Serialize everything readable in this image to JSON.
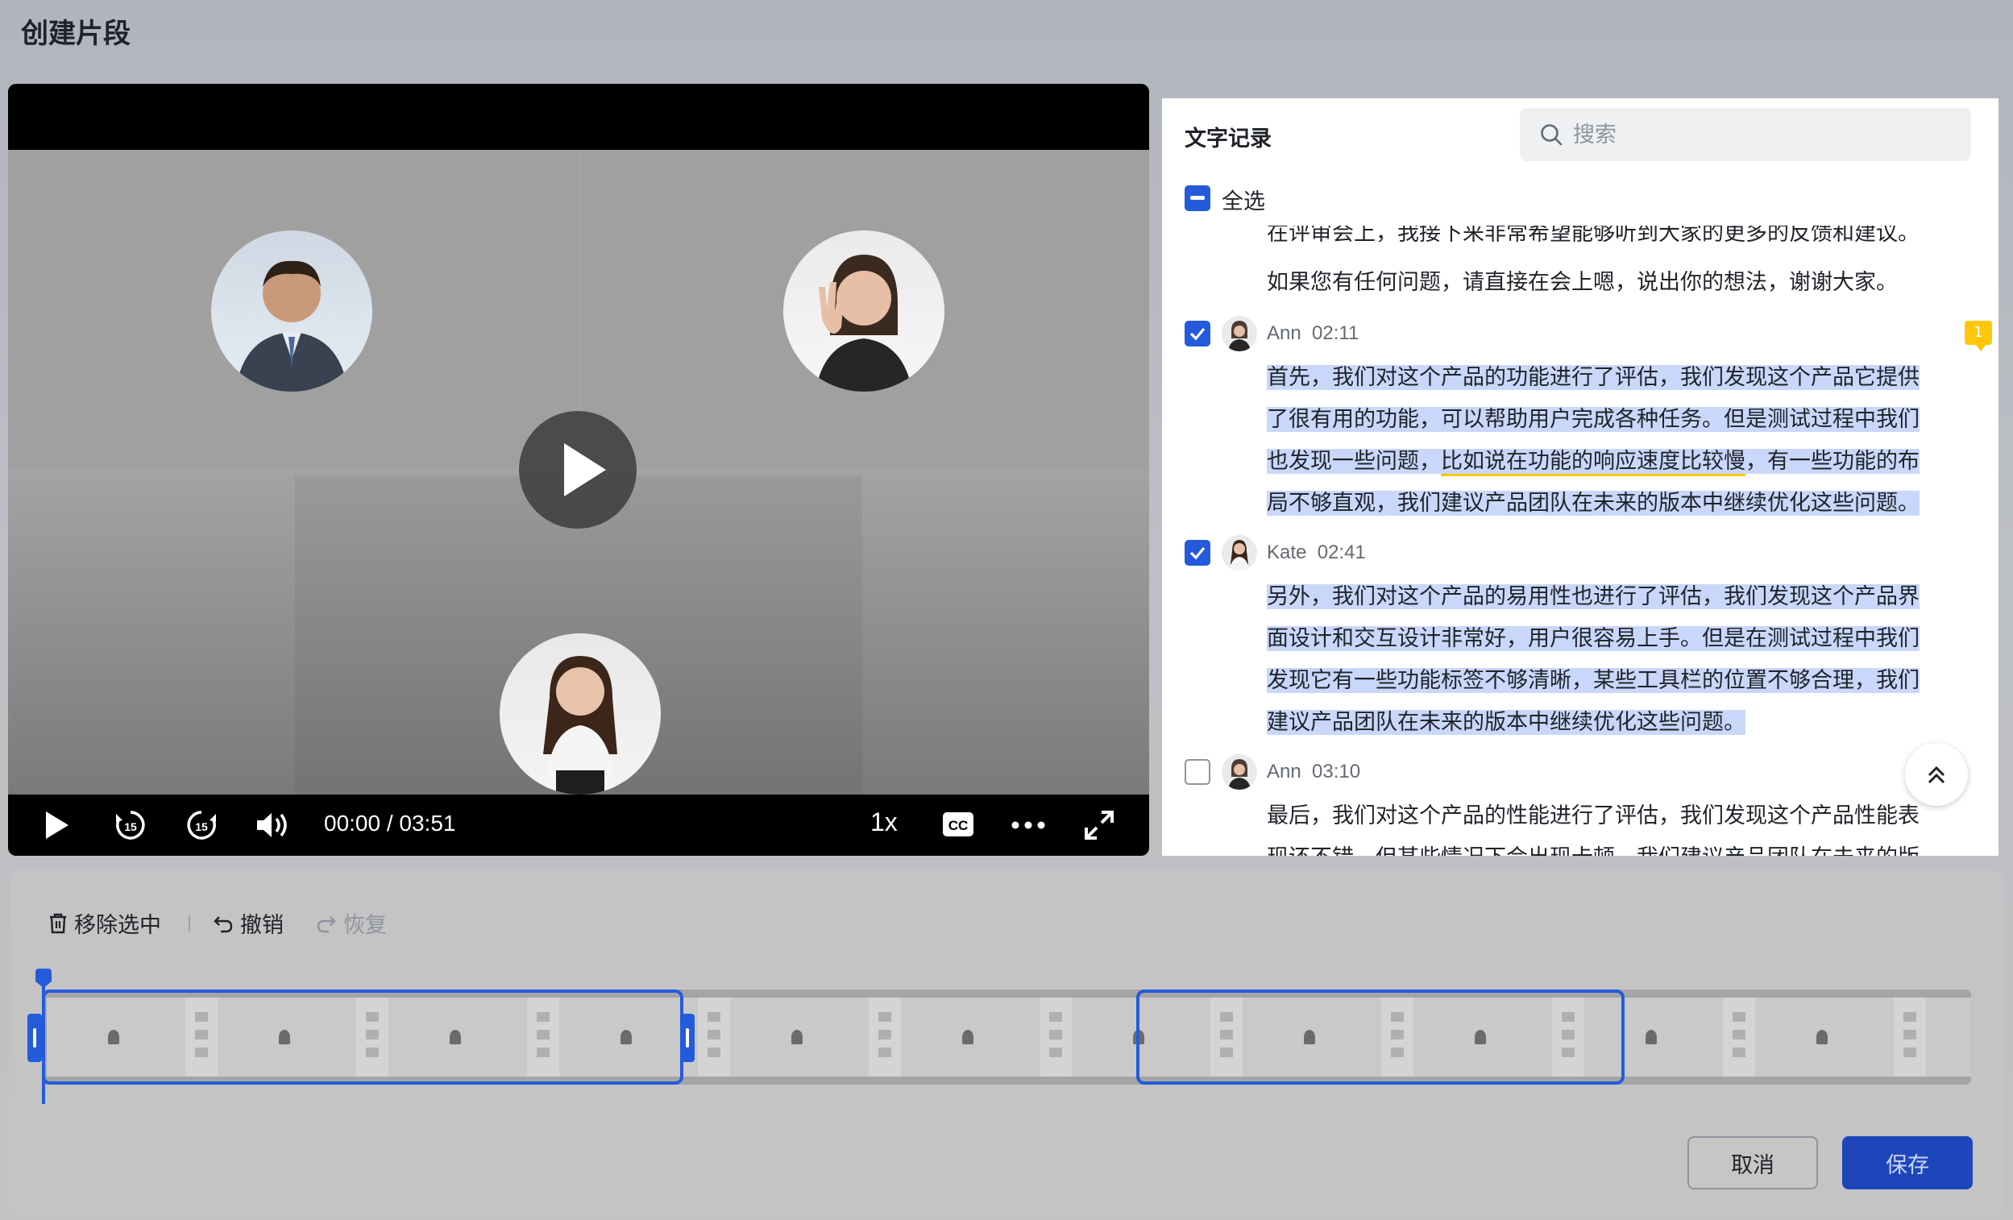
{
  "dialog": {
    "title": "创建片段"
  },
  "player": {
    "time": "00:00 / 03:51",
    "speed": "1x",
    "cc_label": "CC",
    "rewind_label": "15",
    "forward_label": "15"
  },
  "transcript": {
    "title": "文字记录",
    "search_placeholder": "搜索",
    "select_all": "全选",
    "cut_line": "在评审会上，我接下来非常希望能够听到大家的更多的反馈和建议。",
    "intro_line": "如果您有任何问题，请直接在会上嗯，说出你的想法，谢谢大家。",
    "badge": "1",
    "entries": [
      {
        "speaker": "Ann",
        "time": "02:11",
        "checked": true,
        "lines": [
          "首先，我们对这个产品的功能进行了评估，我们发现这个产品它提供",
          "了很有用的功能，可以帮助用户完成各种任务。但是测试过程中我们",
          "也发现一些问题，",
          "比如说在功能的响应速度比较慢",
          "，有一些功能的布",
          "局不够直观，我们建议产品团队在未来的版本中继续优化这些问题。"
        ]
      },
      {
        "speaker": "Kate",
        "time": "02:41",
        "checked": true,
        "lines": [
          "另外，我们对这个产品的易用性也进行了评估，我们发现这个产品界",
          "面设计和交互设计非常好，用户很容易上手。但是在测试过程中我们",
          "发现它有一些功能标签不够清晰，某些工具栏的位置不够合理，我们",
          "建议产品团队在未来的版本中继续优化这些问题。"
        ]
      },
      {
        "speaker": "Ann",
        "time": "03:10",
        "checked": false,
        "lines": [
          "最后，我们对这个产品的性能进行了评估，我们发现这个产品性能表",
          "现还不错，但某些情况下会出现卡顿，我们建议产品团队在未来的版"
        ]
      }
    ]
  },
  "toolbar": {
    "remove_selected": "移除选中",
    "undo": "撤销",
    "redo": "恢复"
  },
  "footer": {
    "cancel": "取消",
    "save": "保存"
  },
  "colors": {
    "accent": "#245bdb",
    "highlight": "#c9d7fa",
    "badge": "#ffc60a"
  }
}
